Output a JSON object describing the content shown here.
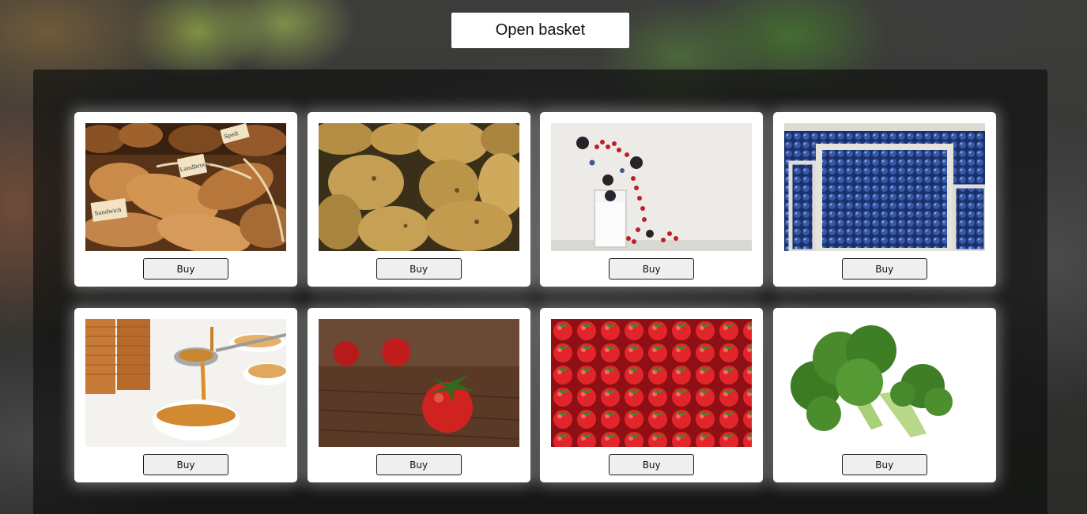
{
  "header": {
    "open_basket_label": "Open basket"
  },
  "products": [
    {
      "image": "bread-photo",
      "buy_label": "Buy"
    },
    {
      "image": "potatoes-photo",
      "buy_label": "Buy"
    },
    {
      "image": "berries-yogurt-photo",
      "buy_label": "Buy"
    },
    {
      "image": "blueberries-photo",
      "buy_label": "Buy"
    },
    {
      "image": "honey-photo",
      "buy_label": "Buy"
    },
    {
      "image": "tomatoes-photo",
      "buy_label": "Buy"
    },
    {
      "image": "strawberries-photo",
      "buy_label": "Buy"
    },
    {
      "image": "broccoli-photo",
      "buy_label": "Buy"
    }
  ],
  "image_labels": {
    "bread_sign_1": "Landbrood",
    "bread_sign_2": "Sandwich",
    "bread_sign_3": "Spelt"
  },
  "colors": {
    "panel": "#0a0c0a",
    "card": "#ffffff",
    "button_bg": "#efefef",
    "button_border": "#1a1a1a"
  }
}
